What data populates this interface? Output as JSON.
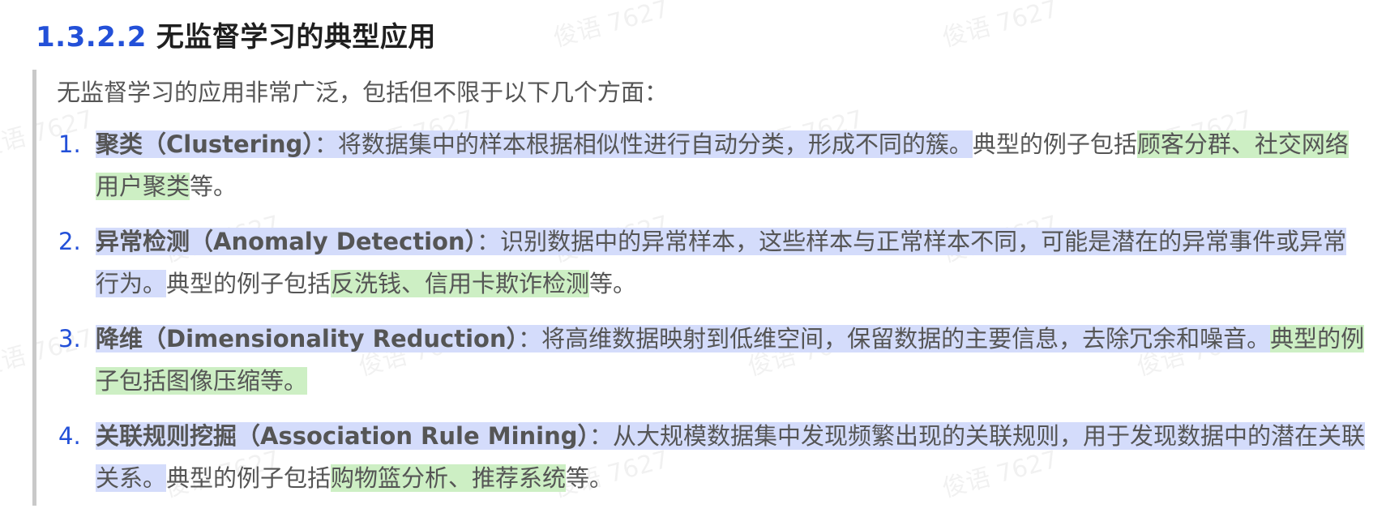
{
  "section": {
    "number": "1.3.2.2",
    "title": "无监督学习的典型应用"
  },
  "intro": "无监督学习的应用非常广泛，包括但不限于以下几个方面：",
  "items": [
    {
      "index": "1.",
      "term": "聚类（Clustering）",
      "colon": "：",
      "desc": "将数据集中的样本根据相似性进行自动分类，形成不同的簇。",
      "lead": "典型的例子包括",
      "examples": "顾客分群、社交网络用户聚类",
      "end": "等。"
    },
    {
      "index": "2.",
      "term": "异常检测（Anomaly Detection）",
      "colon": "：",
      "desc": "识别数据中的异常样本，这些样本与正常样本不同，可能是潜在的异常事件或异常行为。",
      "lead": "典型的例子包括",
      "examples": "反洗钱、信用卡欺诈检测",
      "end": "等。"
    },
    {
      "index": "3.",
      "term": "降维（Dimensionality Reduction）",
      "colon": "：",
      "desc": "将高维数据映射到低维空间，保留数据的主要信息，去除冗余和噪音。",
      "lead": "",
      "examples": "典型的例子包括图像压缩等。",
      "end": ""
    },
    {
      "index": "4.",
      "term": "关联规则挖掘（Association Rule Mining）",
      "colon": "：",
      "desc": "从大规模数据集中发现频繁出现的关联规则，用于发现数据中的潜在关联关系。",
      "lead": "典型的例子包括",
      "examples": "购物篮分析、推荐系统",
      "end": "等。"
    }
  ],
  "watermark": "俊语 7627"
}
